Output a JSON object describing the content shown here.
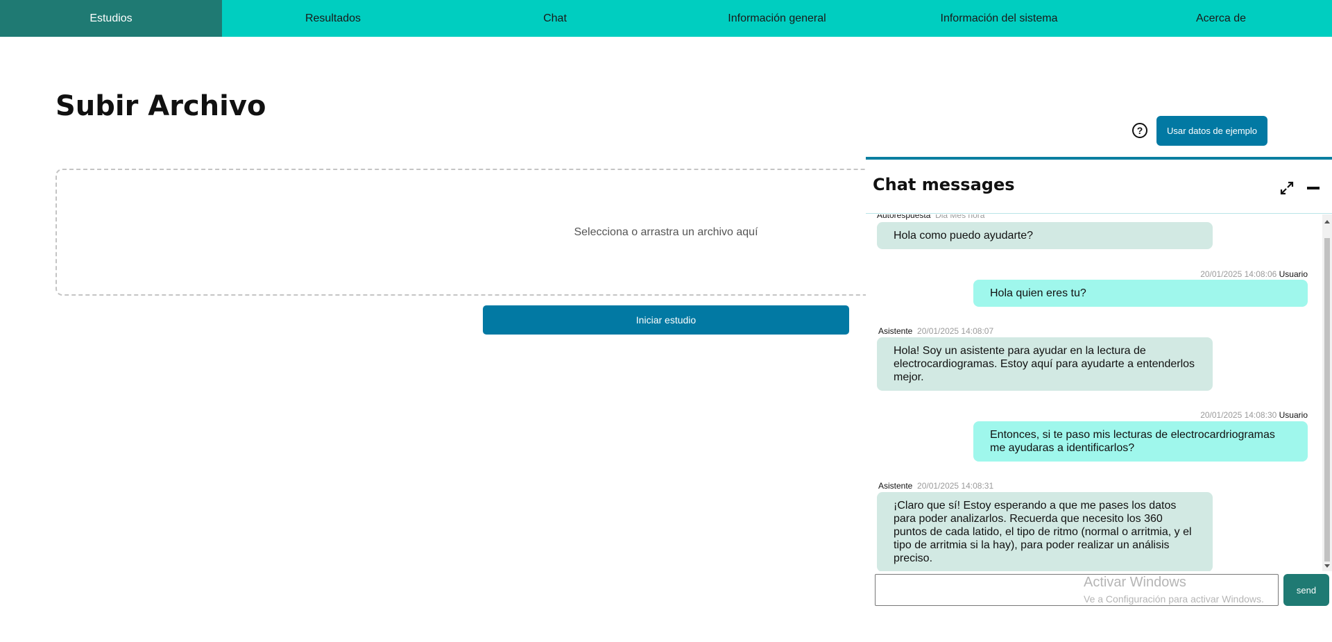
{
  "nav": {
    "items": [
      {
        "label": "Estudios",
        "active": true
      },
      {
        "label": "Resultados"
      },
      {
        "label": "Chat"
      },
      {
        "label": "Información general"
      },
      {
        "label": "Información del sistema"
      },
      {
        "label": "Acerca de"
      }
    ]
  },
  "page": {
    "title": "Subir Archivo",
    "dropzone_text": "Selecciona o arrastra un archivo aquí",
    "start_button": "Iniciar estudio",
    "help_icon": "question-circle-icon",
    "example_button": "Usar datos de ejemplo"
  },
  "chat": {
    "title": "Chat messages",
    "expand_icon": "expand-icon",
    "minimize_icon": "minimize-icon",
    "messages": [
      {
        "sender": "Autorespuesta",
        "time": "Dia Mes hora",
        "text": "Hola como puedo ayudarte?",
        "role": "bot"
      },
      {
        "sender": "Usuario",
        "time": "20/01/2025 14:08:06",
        "text": "Hola quien eres tu?",
        "role": "user"
      },
      {
        "sender": "Asistente",
        "time": "20/01/2025 14:08:07",
        "text": "Hola! Soy un asistente para ayudar en la lectura de electrocardiogramas. Estoy aquí para ayudarte a entenderlos mejor.",
        "role": "bot"
      },
      {
        "sender": "Usuario",
        "time": "20/01/2025 14:08:30",
        "text": "Entonces, si te paso mis lecturas de electrocardriogramas me ayudaras a identificarlos?",
        "role": "user"
      },
      {
        "sender": "Asistente",
        "time": "20/01/2025 14:08:31",
        "text": "¡Claro que sí! Estoy esperando a que me pases los datos para poder analizarlos. Recuerda que necesito los 360 puntos de cada latido, el tipo de ritmo (normal o arritmia, y el tipo de arritmia si la hay), para poder realizar un análisis preciso.",
        "role": "bot"
      }
    ],
    "input_value": "",
    "send_label": "send"
  },
  "watermark": {
    "title": "Activar Windows",
    "subtitle": "Ve a Configuración para activar Windows."
  },
  "colors": {
    "nav_bg": "#00cec0",
    "nav_active": "#1f7a73",
    "primary_button": "#0279a3",
    "bot_bubble": "#d2e9e3",
    "user_bubble": "#9ff7ec",
    "chat_border": "#0a7fa0"
  }
}
